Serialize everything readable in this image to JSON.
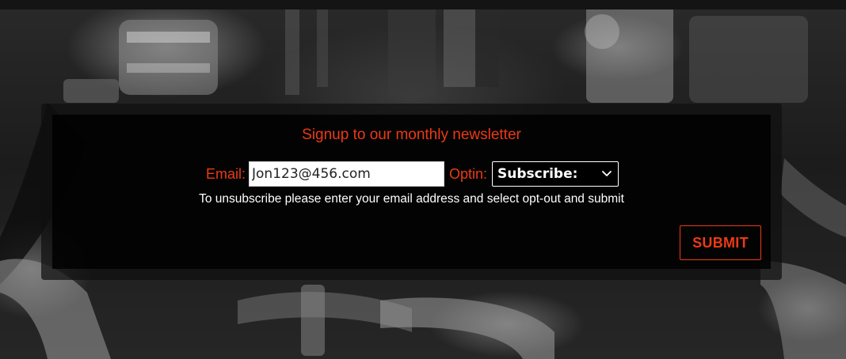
{
  "newsletter": {
    "title": "Signup to our monthly newsletter",
    "email_label": "Email:",
    "email_value": "Jon123@456.com",
    "optin_label": "Optin:",
    "optin_selected": "Subscribe:",
    "hint": "To unsubscribe please enter your email address and select opt-out and submit",
    "submit_label": "SUBMIT"
  },
  "colors": {
    "accent": "#ec3a14",
    "panel_bg": "#000000",
    "hint_text": "#ffffff"
  },
  "icons": {
    "select_arrow": "chevron-down-icon"
  }
}
